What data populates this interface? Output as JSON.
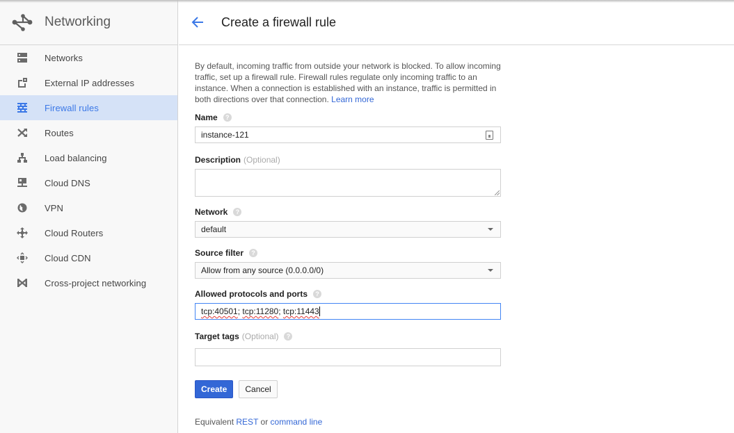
{
  "sidebar": {
    "title": "Networking",
    "items": [
      {
        "label": "Networks",
        "icon": "networks-icon",
        "active": false
      },
      {
        "label": "External IP addresses",
        "icon": "external-ip-icon",
        "active": false
      },
      {
        "label": "Firewall rules",
        "icon": "firewall-icon",
        "active": true
      },
      {
        "label": "Routes",
        "icon": "routes-icon",
        "active": false
      },
      {
        "label": "Load balancing",
        "icon": "load-balancing-icon",
        "active": false
      },
      {
        "label": "Cloud DNS",
        "icon": "cloud-dns-icon",
        "active": false
      },
      {
        "label": "VPN",
        "icon": "vpn-icon",
        "active": false
      },
      {
        "label": "Cloud Routers",
        "icon": "cloud-routers-icon",
        "active": false
      },
      {
        "label": "Cloud CDN",
        "icon": "cloud-cdn-icon",
        "active": false
      },
      {
        "label": "Cross-project networking",
        "icon": "cross-project-icon",
        "active": false
      }
    ]
  },
  "header": {
    "title": "Create a firewall rule",
    "back_icon": "arrow-left-icon"
  },
  "form": {
    "intro": "By default, incoming traffic from outside your network is blocked. To allow incoming traffic, set up a firewall rule. Firewall rules regulate only incoming traffic to an instance. When a connection is established with an instance, traffic is permitted in both directions over that connection.",
    "learn_more": "Learn more",
    "name_label": "Name",
    "name_value": "instance-121",
    "description_label": "Description",
    "optional_text": "(Optional)",
    "description_value": "",
    "network_label": "Network",
    "network_value": "default",
    "source_filter_label": "Source filter",
    "source_filter_value": "Allow from any source (0.0.0.0/0)",
    "protocols_label": "Allowed protocols and ports",
    "protocols_value_parts": [
      "tcp:40501",
      "; ",
      "tcp:11280",
      "; ",
      "tcp:11443"
    ],
    "target_tags_label": "Target tags",
    "target_tags_value": "",
    "help_glyph": "?"
  },
  "actions": {
    "create_label": "Create",
    "cancel_label": "Cancel"
  },
  "footer": {
    "equivalent_prefix": "Equivalent",
    "rest_link": "REST",
    "or_text": "or",
    "command_line_link": "command line"
  },
  "colors": {
    "accent": "#3367d6",
    "active_bg": "#d5e2f7",
    "active_text": "#3b78e7",
    "focus_border": "#4285f4"
  }
}
